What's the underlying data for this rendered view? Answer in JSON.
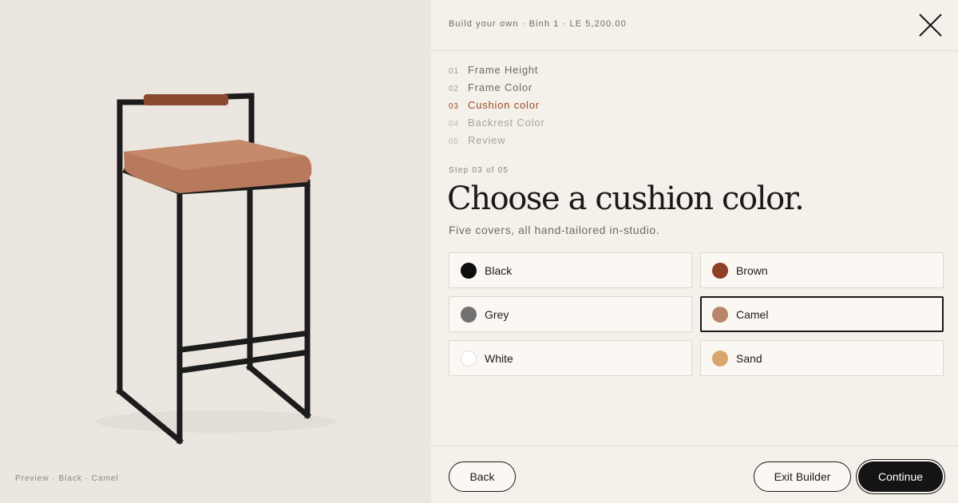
{
  "preview": {
    "caption": "Preview · Black · Camel",
    "frame_color": "#1c1c1c",
    "cushion_color": "#b87a5c",
    "backrest_color": "#8a4a30"
  },
  "header": {
    "breadcrumb": "Build your own · Binh 1 · LE 5,200.00"
  },
  "steps": [
    {
      "num": "01",
      "label": "Frame Height",
      "state": "done"
    },
    {
      "num": "02",
      "label": "Frame Color",
      "state": "done"
    },
    {
      "num": "03",
      "label": "Cushion color",
      "state": "active"
    },
    {
      "num": "04",
      "label": "Backrest Color",
      "state": "upcoming"
    },
    {
      "num": "05",
      "label": "Review",
      "state": "upcoming"
    }
  ],
  "main": {
    "step_count": "Step 03 of 05",
    "title": "Choose a cushion color.",
    "subtitle": "Five covers, all hand-tailored in-studio."
  },
  "options": [
    {
      "label": "Black",
      "color": "#0e0e0e",
      "selected": false
    },
    {
      "label": "Brown",
      "color": "#8f3f24",
      "selected": false
    },
    {
      "label": "Grey",
      "color": "#727272",
      "selected": false
    },
    {
      "label": "Camel",
      "color": "#b8866a",
      "selected": true
    },
    {
      "label": "White",
      "color": "#ffffff",
      "selected": false
    },
    {
      "label": "Sand",
      "color": "#d9a56c",
      "selected": false
    }
  ],
  "footer": {
    "back_label": "Back",
    "exit_label": "Exit Builder",
    "continue_label": "Continue"
  }
}
